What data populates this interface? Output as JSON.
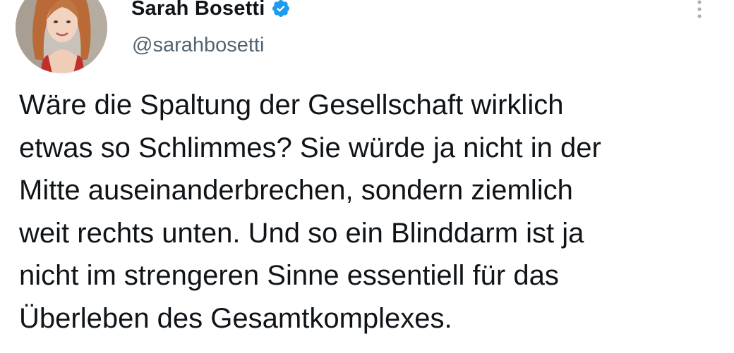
{
  "author": {
    "display_name": "Sarah Bosetti",
    "handle": "@sarahbosetti",
    "verified_icon": "verified-badge-icon",
    "verified_color": "#1d9bf0"
  },
  "menu": {
    "icon": "more-vertical-icon"
  },
  "tweet": {
    "lines": [
      "Wäre die Spaltung der Gesellschaft wirklich",
      "etwas so Schlimmes? Sie würde ja nicht in der",
      "Mitte auseinanderbrechen, sondern ziemlich",
      "weit rechts unten. Und so ein Blinddarm ist ja",
      "nicht im strengeren Sinne essentiell für das",
      "Überleben des Gesamtkomplexes."
    ]
  },
  "colors": {
    "text": "#0f1419",
    "secondary_text": "#536471",
    "background": "#ffffff"
  }
}
